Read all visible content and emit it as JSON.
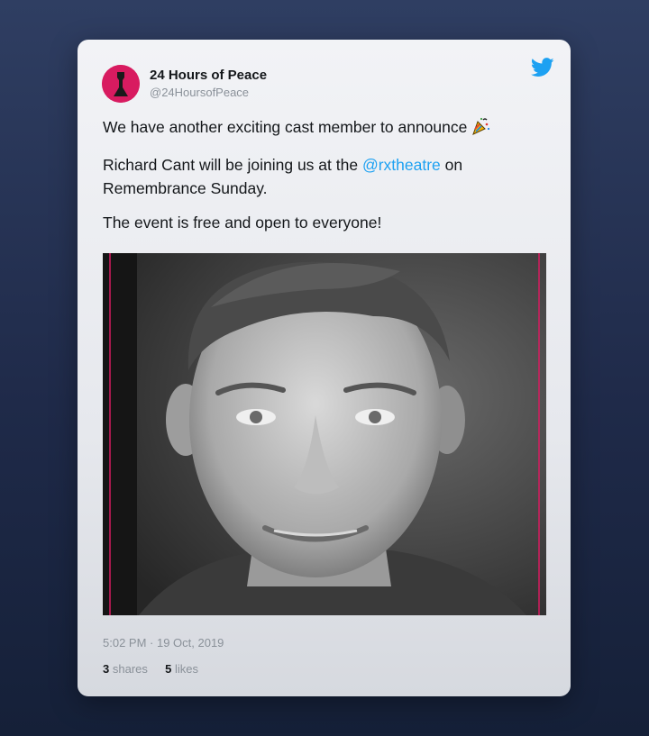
{
  "tweet": {
    "author": {
      "name": "24 Hours of Peace",
      "handle": "@24HoursofPeace",
      "avatar_color": "#d81b60"
    },
    "platform_icon": "twitter-bird-icon",
    "accent_color": "#1da1f2",
    "paragraphs": {
      "p1": "We have another exciting cast member to announce",
      "p1_emoji": "party-popper-icon",
      "p2_before": "Richard Cant will be joining us at the ",
      "p2_mention": "@rxtheatre",
      "p2_after": " on Remembrance Sunday.",
      "p3": "The event is free and open to everyone!"
    },
    "photo": {
      "subject": "black-and-white portrait photo",
      "frame_line_color": "#d81b60"
    },
    "timestamp": "5:02 PM · 19 Oct, 2019",
    "stats": {
      "shares_count": "3",
      "shares_label": "shares",
      "likes_count": "5",
      "likes_label": "likes"
    }
  }
}
